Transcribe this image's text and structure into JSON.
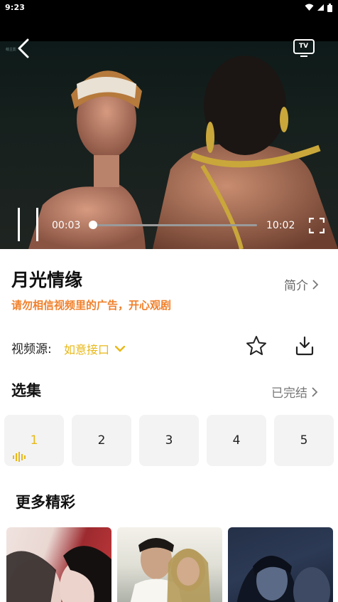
{
  "status_bar": {
    "time": "9:23"
  },
  "player": {
    "watermark": "萌主影",
    "current_time": "00:03",
    "duration": "10:02",
    "progress": 0.005,
    "tv_label": "TV"
  },
  "show": {
    "title": "月光情缘",
    "intro_label": "简介",
    "notice": "请勿相信视频里的广告，开心观剧"
  },
  "source": {
    "label": "视频源:",
    "value": "如意接口"
  },
  "episodes": {
    "heading": "选集",
    "status": "已完结",
    "items": [
      "1",
      "2",
      "3",
      "4",
      "5"
    ],
    "active_index": 0
  },
  "more": {
    "heading": "更多精彩",
    "posters": [
      {
        "caption": ""
      },
      {
        "caption": ""
      },
      {
        "caption": ""
      }
    ]
  },
  "colors": {
    "accent_yellow": "#e8b817",
    "notice_orange": "#f0802b"
  },
  "icons": [
    "back-icon",
    "tv-cast-icon",
    "pause-icon",
    "fullscreen-icon",
    "chevron-right-icon",
    "chevron-down-icon",
    "star-icon",
    "download-icon",
    "sound-wave-icon"
  ]
}
